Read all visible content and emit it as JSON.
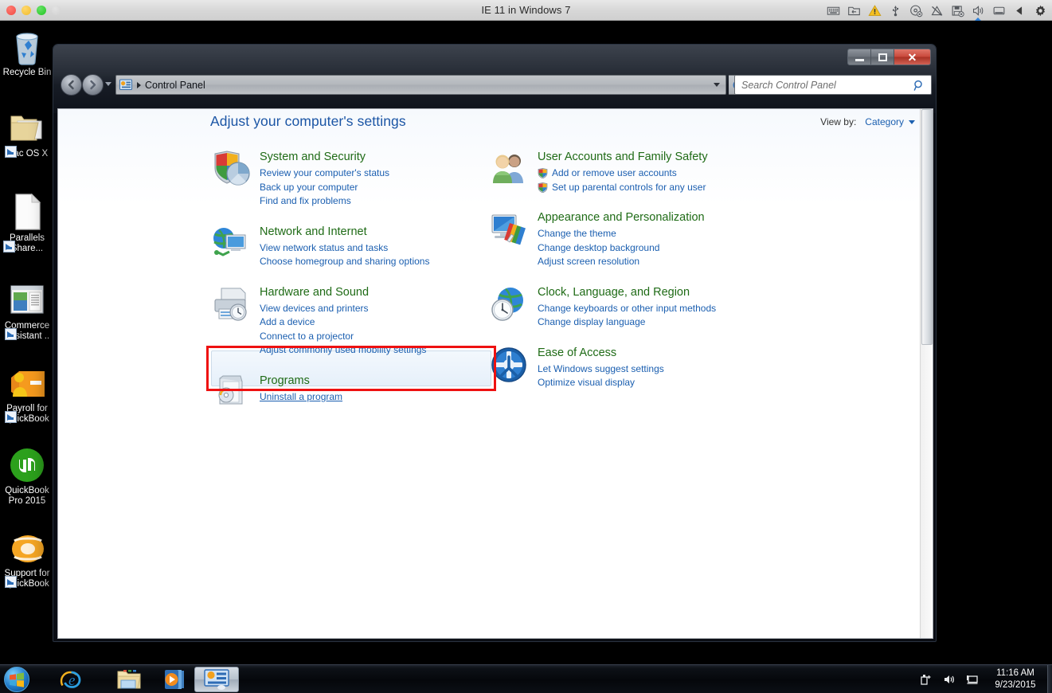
{
  "mac_bar": {
    "title": "IE 11 in Windows 7",
    "traffic_lights": [
      "close-red",
      "minimize-yellow",
      "zoom-green",
      "disabled-gray"
    ],
    "status_icons": [
      "keyboard-icon",
      "shared-folder-icon",
      "warning-icon",
      "usb-icon",
      "cd-drive-icon",
      "network-disconnected-icon",
      "floppy-disk-icon",
      "volume-icon",
      "battery-icon",
      "eject-icon",
      "gear-icon"
    ]
  },
  "desktop": {
    "icons": [
      {
        "name": "recycle-bin",
        "label": "Recycle Bin",
        "shortcut": false
      },
      {
        "name": "mac-os-x",
        "label": "Mac OS X",
        "shortcut": true
      },
      {
        "name": "parallels-shared",
        "label": "Parallels\nShare...",
        "shortcut": true
      },
      {
        "name": "commerce-assistant",
        "label": "Commerce\nAssistant ..",
        "shortcut": true
      },
      {
        "name": "payroll-quickbooks",
        "label": "Payroll for\nQuickBook",
        "shortcut": true
      },
      {
        "name": "quickbooks-pro",
        "label": "QuickBook\nPro 2015",
        "shortcut": false
      },
      {
        "name": "support-quickbooks",
        "label": "Support for\nQuickBook",
        "shortcut": true
      }
    ]
  },
  "window": {
    "controls": {
      "minimize": "–",
      "maximize": "□",
      "close": "✕"
    },
    "navigation": {
      "back": "Back",
      "forward": "Forward",
      "recent_pages": "Recent Pages"
    },
    "address": {
      "value": "Control Panel",
      "refresh": "Refresh"
    },
    "search": {
      "placeholder": "Search Control Panel",
      "value": ""
    }
  },
  "control_panel": {
    "heading": "Adjust your computer's settings",
    "view_by_label": "View by:",
    "view_by_value": "Category",
    "categories_left": [
      {
        "icon": "system-security-icon",
        "title": "System and Security",
        "links": [
          {
            "text": "Review your computer's status",
            "shield": false
          },
          {
            "text": "Back up your computer",
            "shield": false
          },
          {
            "text": "Find and fix problems",
            "shield": false
          }
        ]
      },
      {
        "icon": "network-internet-icon",
        "title": "Network and Internet",
        "links": [
          {
            "text": "View network status and tasks",
            "shield": false
          },
          {
            "text": "Choose homegroup and sharing options",
            "shield": false
          }
        ]
      },
      {
        "icon": "hardware-sound-icon",
        "title": "Hardware and Sound",
        "links": [
          {
            "text": "View devices and printers",
            "shield": false
          },
          {
            "text": "Add a device",
            "shield": false
          },
          {
            "text": "Connect to a projector",
            "shield": false
          },
          {
            "text": "Adjust commonly used mobility settings",
            "shield": false
          }
        ]
      },
      {
        "icon": "programs-icon",
        "title": "Programs",
        "links": [
          {
            "text": "Uninstall a program",
            "shield": false
          }
        ]
      }
    ],
    "categories_right": [
      {
        "icon": "user-accounts-icon",
        "title": "User Accounts and Family Safety",
        "links": [
          {
            "text": "Add or remove user accounts",
            "shield": true
          },
          {
            "text": "Set up parental controls for any user",
            "shield": true
          }
        ]
      },
      {
        "icon": "appearance-icon",
        "title": "Appearance and Personalization",
        "links": [
          {
            "text": "Change the theme",
            "shield": false
          },
          {
            "text": "Change desktop background",
            "shield": false
          },
          {
            "text": "Adjust screen resolution",
            "shield": false
          }
        ]
      },
      {
        "icon": "clock-language-icon",
        "title": "Clock, Language, and Region",
        "links": [
          {
            "text": "Change keyboards or other input methods",
            "shield": false
          },
          {
            "text": "Change display language",
            "shield": false
          }
        ]
      },
      {
        "icon": "ease-of-access-icon",
        "title": "Ease of Access",
        "links": [
          {
            "text": "Let Windows suggest settings",
            "shield": false
          },
          {
            "text": "Optimize visual display",
            "shield": false
          }
        ]
      }
    ],
    "highlight": {
      "target": "Programs",
      "color": "#ee1111"
    }
  },
  "taskbar": {
    "start_button": "Start",
    "items": [
      {
        "name": "taskbar-internet-explorer",
        "label": "Internet Explorer",
        "active": false
      },
      {
        "name": "taskbar-windows-explorer",
        "label": "Windows Explorer",
        "active": false
      },
      {
        "name": "taskbar-media-player",
        "label": "Windows Media Player",
        "active": false
      },
      {
        "name": "taskbar-control-panel",
        "label": "Control Panel",
        "active": true
      }
    ],
    "tray_icons": [
      "safely-remove-hardware-icon",
      "volume-icon",
      "network-icon"
    ],
    "clock": {
      "time": "11:16 AM",
      "date": "9/23/2015"
    }
  }
}
